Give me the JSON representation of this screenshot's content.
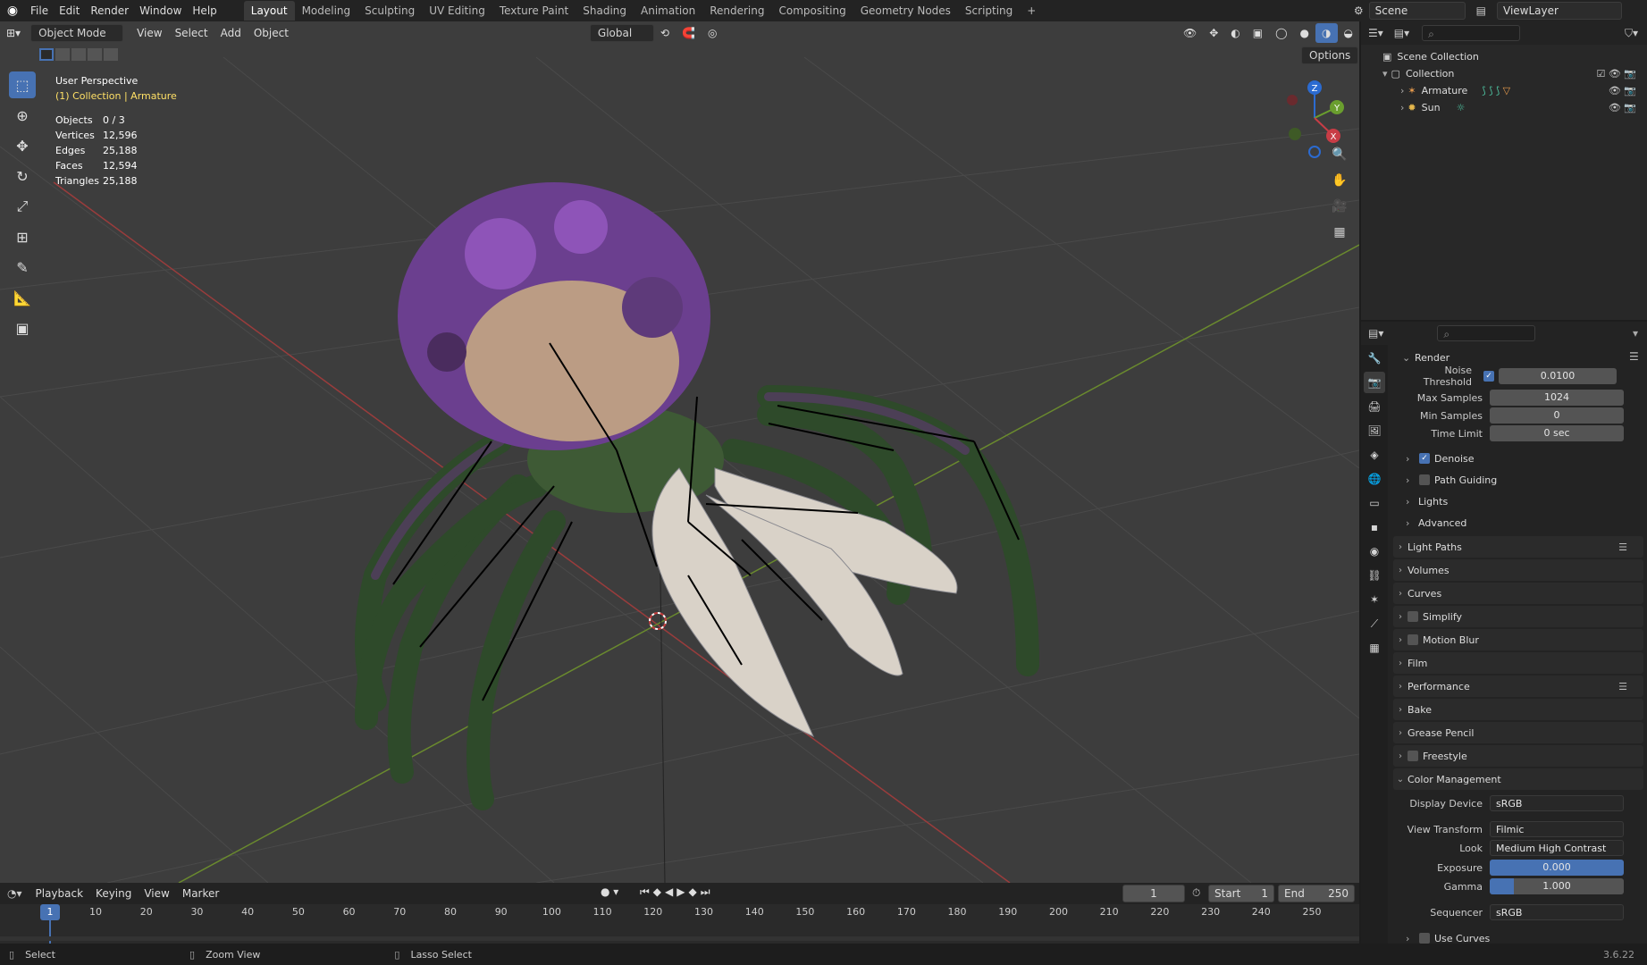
{
  "topbar": {
    "menus": [
      "File",
      "Edit",
      "Render",
      "Window",
      "Help"
    ],
    "workspaces": [
      "Layout",
      "Modeling",
      "Sculpting",
      "UV Editing",
      "Texture Paint",
      "Shading",
      "Animation",
      "Rendering",
      "Compositing",
      "Geometry Nodes",
      "Scripting"
    ],
    "active_workspace": "Layout",
    "add_tab": "+",
    "scene_name": "Scene",
    "view_layer": "ViewLayer"
  },
  "viewport_header": {
    "mode": "Object Mode",
    "menus": [
      "View",
      "Select",
      "Add",
      "Object"
    ],
    "transform_orientation": "Global",
    "options_label": "Options"
  },
  "overlay": {
    "perspective": "User Perspective",
    "context": "(1) Collection | Armature",
    "stats": [
      {
        "label": "Objects",
        "value": "0 / 3"
      },
      {
        "label": "Vertices",
        "value": "12,596"
      },
      {
        "label": "Edges",
        "value": "25,188"
      },
      {
        "label": "Faces",
        "value": "12,594"
      },
      {
        "label": "Triangles",
        "value": "25,188"
      }
    ]
  },
  "gizmo": {
    "z": "Z",
    "y": "Y",
    "x": "X"
  },
  "outliner": {
    "root": "Scene Collection",
    "collection": "Collection",
    "items": [
      "Armature",
      "Sun"
    ]
  },
  "properties": {
    "render_panel": "Render",
    "noise_threshold_label": "Noise Threshold",
    "noise_threshold": "0.0100",
    "max_samples_label": "Max Samples",
    "max_samples": "1024",
    "min_samples_label": "Min Samples",
    "min_samples": "0",
    "time_limit_label": "Time Limit",
    "time_limit": "0 sec",
    "subpanels": [
      "Denoise",
      "Path Guiding",
      "Lights",
      "Advanced"
    ],
    "panels": [
      "Light Paths",
      "Volumes",
      "Curves",
      "Simplify",
      "Motion Blur",
      "Film",
      "Performance",
      "Bake",
      "Grease Pencil",
      "Freestyle"
    ],
    "color_management": "Color Management",
    "display_device_label": "Display Device",
    "display_device": "sRGB",
    "view_transform_label": "View Transform",
    "view_transform": "Filmic",
    "look_label": "Look",
    "look": "Medium High Contrast",
    "exposure_label": "Exposure",
    "exposure": "0.000",
    "gamma_label": "Gamma",
    "gamma": "1.000",
    "sequencer_label": "Sequencer",
    "sequencer": "sRGB",
    "use_curves": "Use Curves"
  },
  "timeline": {
    "menus": [
      "Playback",
      "Keying",
      "View",
      "Marker"
    ],
    "current_frame": "1",
    "start_label": "Start",
    "start": "1",
    "end_label": "End",
    "end": "250",
    "ticks": [
      "1",
      "10",
      "20",
      "30",
      "40",
      "50",
      "60",
      "70",
      "80",
      "90",
      "100",
      "110",
      "120",
      "130",
      "140",
      "150",
      "160",
      "170",
      "180",
      "190",
      "200",
      "210",
      "220",
      "230",
      "240",
      "250"
    ]
  },
  "statusbar": {
    "select": "Select",
    "zoom": "Zoom View",
    "lasso": "Lasso Select",
    "version": "3.6.22"
  },
  "colors": {
    "accent": "#4772b3",
    "viewport": "#3d3d3d",
    "active_text": "#ffe066"
  }
}
